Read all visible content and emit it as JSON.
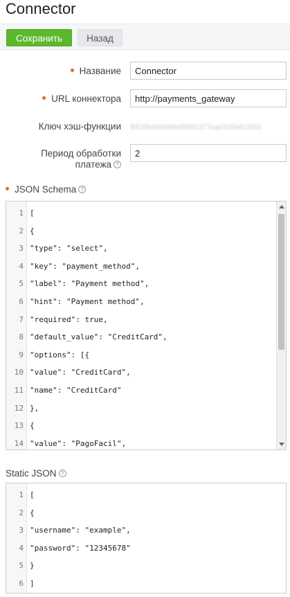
{
  "page": {
    "title": "Connector"
  },
  "toolbar": {
    "save_label": "Сохранить",
    "back_label": "Назад"
  },
  "form": {
    "name": {
      "label": "Название",
      "value": "Connector",
      "required": true
    },
    "url": {
      "label": "URL коннектора",
      "value": "http://payments_gateway",
      "required": true
    },
    "hash": {
      "label": "Ключ хэш-функции",
      "value": "fbf29b460d6649891377eac929e61859"
    },
    "period": {
      "label_line1": "Период обработки",
      "label_line2": "платежа",
      "value": "2"
    }
  },
  "json_schema": {
    "label": "JSON Schema",
    "required": true,
    "lines": [
      {
        "n": "1",
        "text": "["
      },
      {
        "n": "2",
        "text": "{"
      },
      {
        "n": "3",
        "text": "\"type\": \"select\","
      },
      {
        "n": "4",
        "text": "\"key\": \"payment_method\","
      },
      {
        "n": "5",
        "text": "\"label\": \"Payment method\","
      },
      {
        "n": "6",
        "text": "\"hint\": \"Payment method\","
      },
      {
        "n": "7",
        "text": "\"required\": true,"
      },
      {
        "n": "8",
        "text": "\"default_value\": \"CreditCard\","
      },
      {
        "n": "9",
        "text": "\"options\": [{"
      },
      {
        "n": "10",
        "text": "\"value\": \"CreditCard\","
      },
      {
        "n": "11",
        "text": "\"name\": \"CreditCard\""
      },
      {
        "n": "12",
        "text": "},"
      },
      {
        "n": "13",
        "text": "{"
      },
      {
        "n": "14",
        "text": "\"value\": \"PagoFacil\","
      }
    ]
  },
  "static_json": {
    "label": "Static JSON",
    "lines": [
      {
        "n": "1",
        "text": "["
      },
      {
        "n": "2",
        "text": "{"
      },
      {
        "n": "3",
        "text": "\"username\": \"example\","
      },
      {
        "n": "4",
        "text": "\"password\": \"12345678\""
      },
      {
        "n": "5",
        "text": "}"
      },
      {
        "n": "6",
        "text": "]"
      }
    ]
  },
  "icons": {
    "help": "question-circle-icon",
    "required": "required-dot-icon"
  },
  "colors": {
    "accent": "#5cb82c",
    "required": "#e8642c"
  }
}
